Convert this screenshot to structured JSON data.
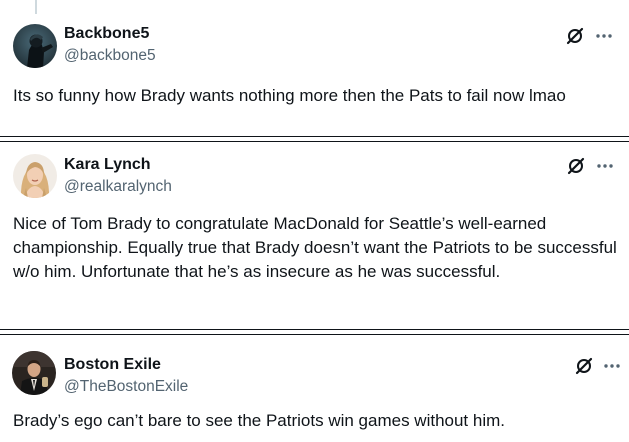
{
  "tweets": [
    {
      "author": {
        "name": "Backbone5",
        "handle": "@backbone5",
        "avatar": "dark-figure-avatar"
      },
      "text": "Its so funny how Brady wants nothing more then the Pats to fail now lmao",
      "actions": {
        "grok": "grok-icon",
        "more": "more-icon"
      }
    },
    {
      "author": {
        "name": "Kara Lynch",
        "handle": "@realkaralynch",
        "avatar": "blonde-woman-avatar"
      },
      "text": "Nice of Tom Brady to congratulate MacDonald for Seattle’s well-earned championship. Equally true that Brady doesn’t want the Patriots to be successful w/o him. Unfortunate that he’s as insecure as he was successful.",
      "actions": {
        "grok": "grok-icon",
        "more": "more-icon"
      }
    },
    {
      "author": {
        "name": "Boston Exile",
        "handle": "@TheBostonExile",
        "avatar": "man-in-suit-avatar"
      },
      "text": "Brady’s ego can’t bare to see the Patriots win games without him.",
      "actions": {
        "grok": "grok-icon",
        "more": "more-icon"
      }
    }
  ],
  "colors": {
    "text": "#0f1419",
    "secondary": "#536471",
    "thread_line": "#cfd9de",
    "divider": "#0f1419",
    "background": "#ffffff"
  }
}
